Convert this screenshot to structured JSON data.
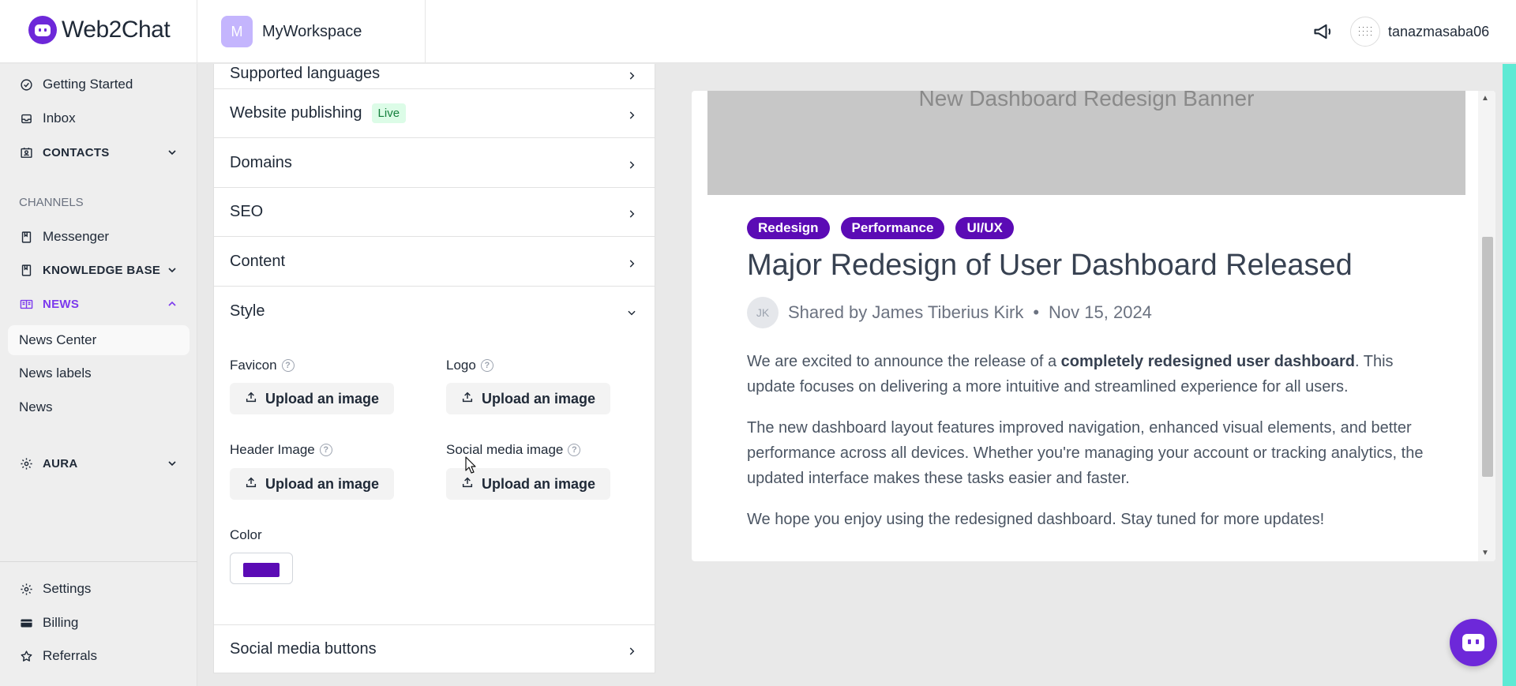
{
  "header": {
    "brand": "Web2Chat",
    "workspace_initial": "M",
    "workspace_name": "MyWorkspace",
    "username": "tanazmasaba06"
  },
  "sidebar": {
    "items": {
      "getting_started": "Getting Started",
      "inbox": "Inbox",
      "contacts": "CONTACTS",
      "channels_label": "CHANNELS",
      "messenger": "Messenger",
      "knowledge_base": "KNOWLEDGE BASE",
      "news": "NEWS",
      "news_center": "News Center",
      "news_labels": "News labels",
      "news_sub": "News",
      "aura": "AURA",
      "settings": "Settings",
      "billing": "Billing",
      "referrals": "Referrals"
    },
    "active_color": "#7c3aed"
  },
  "settings_panel": {
    "rows": {
      "supported_languages": "Supported languages",
      "website_publishing": "Website publishing",
      "live_badge": "Live",
      "domains": "Domains",
      "seo": "SEO",
      "content": "Content",
      "style": "Style",
      "social_media_buttons": "Social media buttons"
    },
    "style": {
      "favicon_label": "Favicon",
      "logo_label": "Logo",
      "header_image_label": "Header Image",
      "social_media_image_label": "Social media image",
      "upload_label": "Upload an image",
      "color_label": "Color",
      "color_value": "#5b0bb5"
    }
  },
  "preview": {
    "banner_text": "New Dashboard Redesign Banner",
    "tags": [
      "Redesign",
      "Performance",
      "UI/UX"
    ],
    "title": "Major Redesign of User Dashboard Released",
    "author_initials": "JK",
    "shared_by": "Shared by James Tiberius Kirk",
    "separator": "•",
    "date": "Nov 15, 2024",
    "p1_before": "We are excited to announce the release of a ",
    "p1_bold": "completely redesigned user dashboard",
    "p1_after": ". This update focuses on delivering a more intuitive and streamlined experience for all users.",
    "p2": "The new dashboard layout features improved navigation, enhanced visual elements, and better performance across all devices. Whether you're managing your account or tracking analytics, the updated interface makes these tasks easier and faster.",
    "p3": "We hope you enjoy using the redesigned dashboard. Stay tuned for more updates!",
    "tag_color": "#5b0bb5"
  }
}
